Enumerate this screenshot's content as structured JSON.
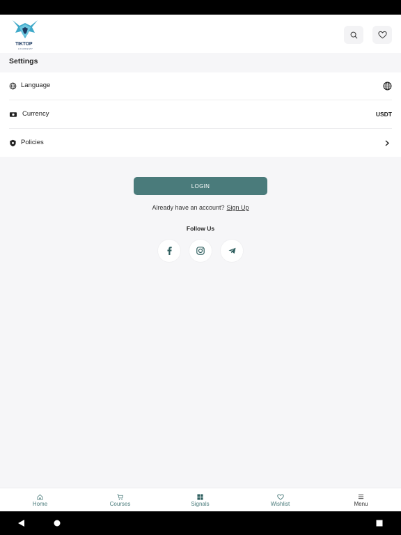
{
  "header": {
    "logo_text": "TIKTOP",
    "logo_sub": "ACADEMY"
  },
  "settings": {
    "title": "Settings",
    "rows": [
      {
        "label": "Language",
        "value": ""
      },
      {
        "label": "Currency",
        "value": "USDT"
      },
      {
        "label": "Policies",
        "value": ""
      }
    ]
  },
  "auth": {
    "login_label": "LOGIN",
    "account_prompt": "Already have an account?",
    "signup_label": "Sign Up"
  },
  "social": {
    "title": "Follow Us",
    "items": [
      "facebook-icon",
      "instagram-icon",
      "telegram-icon"
    ]
  },
  "bottom_nav": {
    "items": [
      {
        "label": "Home",
        "icon": "home-icon"
      },
      {
        "label": "Courses",
        "icon": "cart-icon"
      },
      {
        "label": "Signals",
        "icon": "grid-icon"
      },
      {
        "label": "Wishlist",
        "icon": "heart-icon"
      },
      {
        "label": "Menu",
        "icon": "menu-icon"
      }
    ]
  },
  "colors": {
    "accent": "#4a7b7b",
    "background": "#f6f6f8",
    "logo_blue": "#3fa9c9"
  }
}
